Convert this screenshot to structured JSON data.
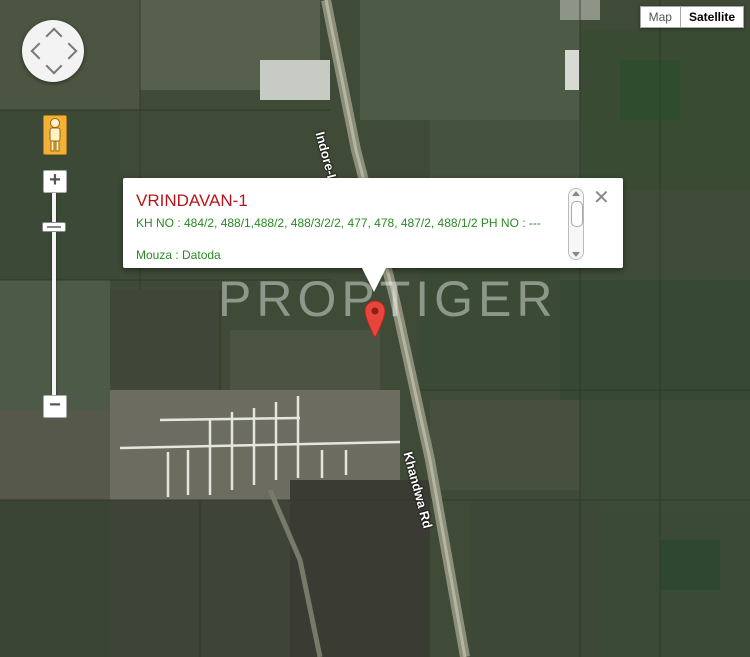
{
  "map_type_control": {
    "map_label": "Map",
    "satellite_label": "Satellite",
    "active": "Satellite"
  },
  "controls": {
    "pan": "pan-control",
    "street_view": "pegman-icon",
    "zoom_in_label": "+",
    "zoom_out_label": "−"
  },
  "info_window": {
    "title": "VRINDAVAN-1",
    "kh_no": "KH NO : 484/2, 488/1,488/2, 488/3/2/2, 477, 478, 487/2, 488/1/2 PH NO : ---",
    "mouza": "Mouza : Datoda",
    "close_label": "✕"
  },
  "roads": {
    "north": "Indore-Icch",
    "south": "Khandwa Rd"
  },
  "watermark": "PROPTIGER",
  "colors": {
    "title": "#b6171c",
    "detail_text": "#2a8a22",
    "pin": "#e8453c"
  }
}
